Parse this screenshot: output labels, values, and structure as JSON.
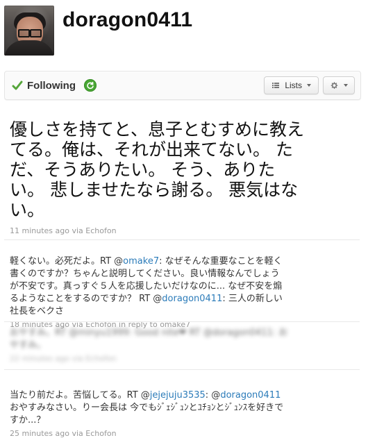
{
  "profile": {
    "username": "doragon0411"
  },
  "follow_bar": {
    "following_label": "Following",
    "lists_label": "Lists"
  },
  "tweets": [
    {
      "text": "優しさを持てと、息子とむすめに教え\nてる。俺は、それが出来てない。 た\nだ、そうありたい。 そう、ありた\nい。 悲しませたなら謝る。 悪気はな\nい。",
      "meta": "11 minutes ago via Echofon"
    },
    {
      "text_prefix": "軽くない。必死だよ。RT @",
      "mention1": "omake7",
      "text_mid": ": なぜそんな重要なことを軽く\n書くのですか？ちゃんと説明してください。良い情報なんでしょう\nが不安です。真っすぐ５人を応援したいだけなのに... なぜ不安を煽\nるようなことをするのですか？ RT @",
      "mention2": "doragon0411",
      "text_suffix": ": 三人の新しい\n社長をベクさ",
      "meta": "18 minutes ago via Echofon in reply to omake7"
    },
    {
      "text": "おやすみ。RT @minyu1999: Good nite❤ RT @doragon0411: お\nやすみ。",
      "meta": "22 minutes ago via Echofon"
    },
    {
      "text_prefix": "当たり前だよ。苦悩してる。RT @",
      "mention1": "jejejuju3535",
      "text_mid": ": @",
      "mention2": "doragon0411",
      "text_suffix": "\nおやすみなさい。りー会長は 今でもｼﾞｪｼﾞｭﾝとﾕﾁｮﾝとｼﾞｭﾝｽを好きで\nすか...？",
      "meta": "25 minutes ago via Echofon"
    }
  ],
  "colors": {
    "mention": "#2b7bb9",
    "meta": "#999999",
    "check": "#55a53a",
    "refresh": "#49a634"
  },
  "icons": {
    "avatar": "user-photo",
    "following_check": "check-icon",
    "refresh": "refresh-icon",
    "lists": "list-icon",
    "settings": "gear-icon",
    "dropdown": "chevron-down-icon"
  }
}
